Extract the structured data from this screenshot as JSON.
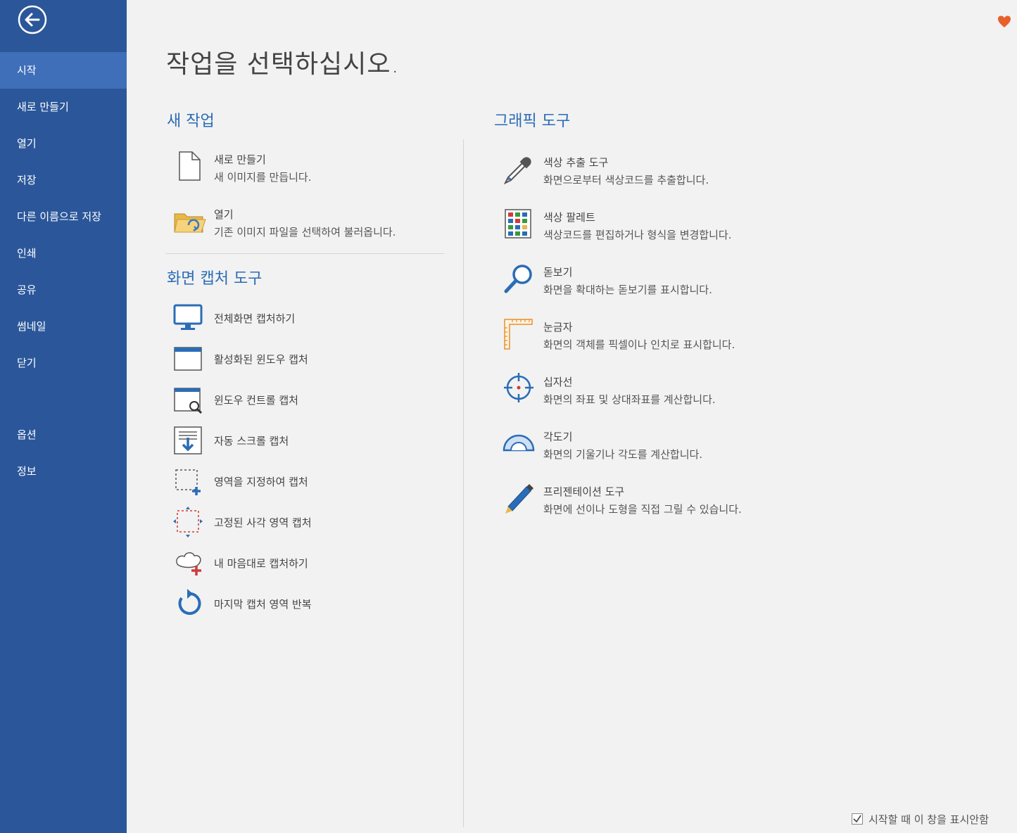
{
  "sidebar": {
    "back_icon": "back-arrow-icon",
    "items": [
      {
        "label": "시작",
        "active": true
      },
      {
        "label": "새로 만들기"
      },
      {
        "label": "열기"
      },
      {
        "label": "저장"
      },
      {
        "label": "다른 이름으로 저장"
      },
      {
        "label": "인쇄"
      },
      {
        "label": "공유"
      },
      {
        "label": "썸네일"
      },
      {
        "label": "닫기"
      },
      {
        "label": "옵션"
      },
      {
        "label": "정보"
      }
    ]
  },
  "main": {
    "title": "작업을 선택하십시오.",
    "new_task": {
      "heading": "새 작업",
      "items": [
        {
          "icon": "blank-document-icon",
          "title": "새로 만들기",
          "desc": "새 이미지를 만듭니다."
        },
        {
          "icon": "open-folder-icon",
          "title": "열기",
          "desc": "기존 이미지 파일을 선택하여 불러옵니다."
        }
      ]
    },
    "capture": {
      "heading": "화면 캡처 도구",
      "items": [
        {
          "icon": "monitor-icon",
          "title": "전체화면 캡처하기"
        },
        {
          "icon": "window-icon",
          "title": "활성화된 윈도우 캡처"
        },
        {
          "icon": "window-control-icon",
          "title": "윈도우 컨트롤 캡처"
        },
        {
          "icon": "scroll-capture-icon",
          "title": "자동 스크롤 캡처"
        },
        {
          "icon": "region-select-icon",
          "title": "영역을 지정하여 캡처"
        },
        {
          "icon": "fixed-rect-icon",
          "title": "고정된 사각 영역 캡처"
        },
        {
          "icon": "freeform-icon",
          "title": "내 마음대로 캡처하기"
        },
        {
          "icon": "repeat-icon",
          "title": "마지막 캡처 영역 반복"
        }
      ]
    },
    "graphics": {
      "heading": "그래픽 도구",
      "items": [
        {
          "icon": "eyedropper-icon",
          "title": "색상 추출 도구",
          "desc": "화면으로부터 색상코드를 추출합니다."
        },
        {
          "icon": "palette-icon",
          "title": "색상 팔레트",
          "desc": "색상코드를 편집하거나 형식을 변경합니다."
        },
        {
          "icon": "magnifier-icon",
          "title": "돋보기",
          "desc": "화면을 확대하는 돋보기를 표시합니다."
        },
        {
          "icon": "ruler-icon",
          "title": "눈금자",
          "desc": "화면의 객체를 픽셀이나 인치로 표시합니다."
        },
        {
          "icon": "crosshair-icon",
          "title": "십자선",
          "desc": "화면의 좌표 및 상대좌표를 계산합니다."
        },
        {
          "icon": "protractor-icon",
          "title": "각도기",
          "desc": "화면의 기울기나 각도를 계산합니다."
        },
        {
          "icon": "pen-icon",
          "title": "프리젠테이션 도구",
          "desc": "화면에 선이나 도형을 직접 그릴 수 있습니다."
        }
      ]
    }
  },
  "footer": {
    "checkbox_label": "시작할 때 이 창을 표시안함",
    "checked": true
  },
  "colors": {
    "sidebar": "#2b579a",
    "sidebar_active": "#3f6fb9",
    "heading": "#2b6cb6",
    "heart": "#e8602c"
  }
}
